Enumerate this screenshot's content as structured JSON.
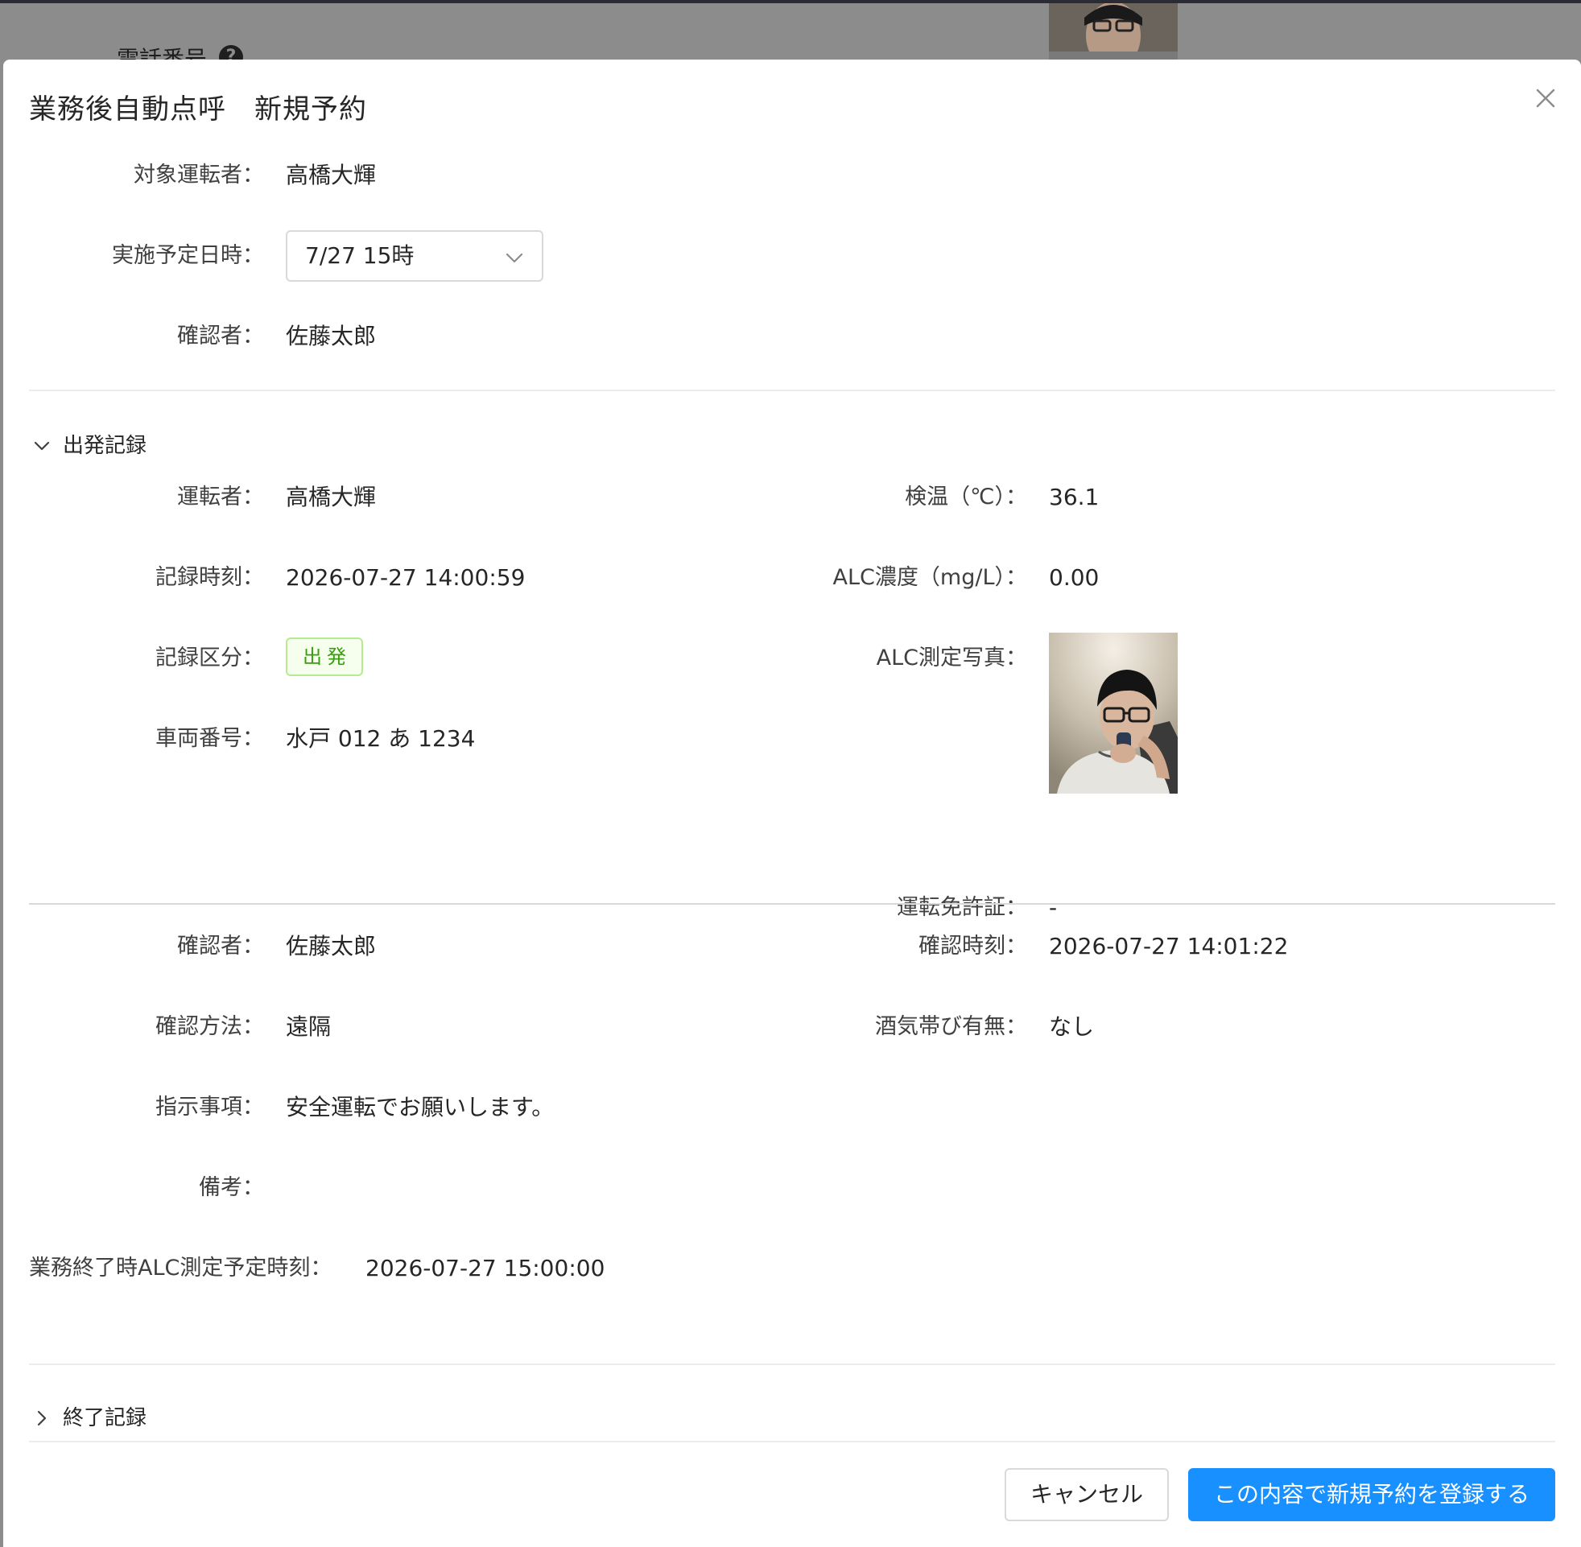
{
  "modal": {
    "title": "業務後自動点呼　新規予約",
    "top_fields": {
      "target_driver_label": "対象運転者：",
      "target_driver_value": "高橋大輝",
      "scheduled_datetime_label": "実施予定日時：",
      "scheduled_datetime_value": "7/27 15時",
      "confirmer_label": "確認者：",
      "confirmer_value": "佐藤太郎"
    },
    "departure_section": {
      "header": "出発記録",
      "expanded": true,
      "driver_label": "運転者：",
      "driver_value": "高橋大輝",
      "temperature_label": "検温（℃）：",
      "temperature_value": "36.1",
      "record_time_label": "記録時刻：",
      "record_time_value": "2026-07-27 14:00:59",
      "alc_label": "ALC濃度（mg/L）：",
      "alc_value": "0.00",
      "record_type_label": "記録区分：",
      "record_type_tag": "出発",
      "alc_photo_label": "ALC測定写真：",
      "vehicle_label": "車両番号：",
      "vehicle_value": "水戸 012 あ 1234",
      "license_label": "運転免許証：",
      "license_value": "-",
      "confirmer_label": "確認者：",
      "confirmer_value": "佐藤太郎",
      "confirm_time_label": "確認時刻：",
      "confirm_time_value": "2026-07-27 14:01:22",
      "confirm_method_label": "確認方法：",
      "confirm_method_value": "遠隔",
      "alcohol_presence_label": "酒気帯び有無：",
      "alcohol_presence_value": "なし",
      "instructions_label": "指示事項：",
      "instructions_value": "安全運転でお願いします。",
      "notes_label": "備考：",
      "notes_value": "",
      "end_alc_time_label": "業務終了時ALC測定予定時刻：",
      "end_alc_time_value": "2026-07-27 15:00:00"
    },
    "end_section": {
      "header": "終了記録",
      "expanded": false
    },
    "footer": {
      "cancel_label": "キャンセル",
      "submit_label": "この内容で新規予約を登録する"
    }
  },
  "background": {
    "phone_label": "電話番号"
  },
  "colors": {
    "primary": "#1890ff",
    "tag_green_text": "#389e0d",
    "tag_green_bg": "#f6ffed",
    "tag_green_border": "#b7eb8f",
    "overlay": "#8c8c8c"
  },
  "icons": {
    "close": "close-icon",
    "select_arrow": "chevron-down-icon",
    "expanded": "chevron-down-icon",
    "collapsed": "chevron-right-icon",
    "help": "question-circle-icon"
  }
}
